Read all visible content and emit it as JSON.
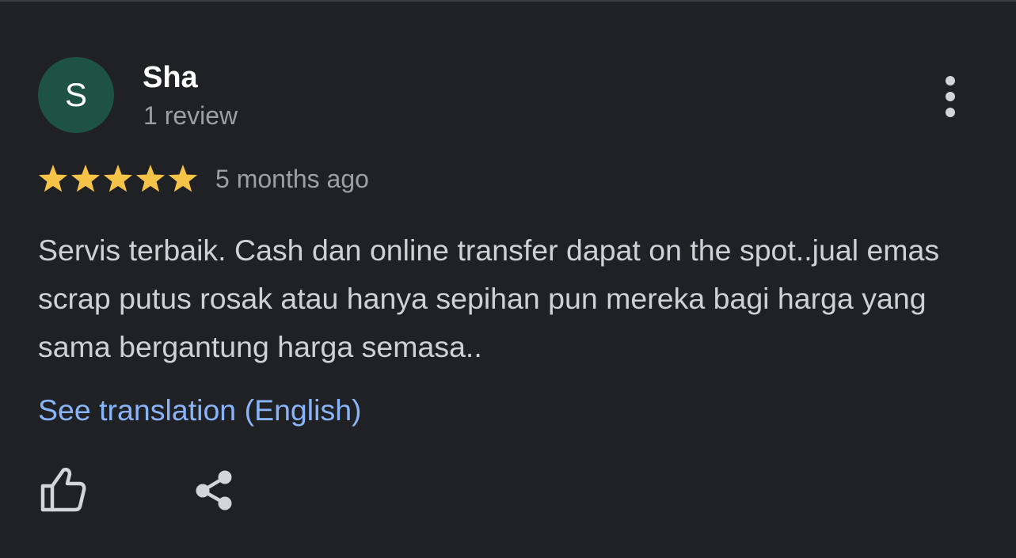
{
  "review": {
    "author": {
      "initial": "S",
      "name": "Sha",
      "review_count": "1 review",
      "avatar_color": "#1e5242"
    },
    "rating": 5,
    "max_rating": 5,
    "time_ago": "5 months ago",
    "text": "Servis terbaik. Cash dan online transfer dapat on the spot..jual emas scrap putus rosak atau hanya sepihan pun mereka bagi harga yang sama bergantung harga semasa..",
    "translate_link": "See translation (English)"
  },
  "icons": {
    "more": "more-vertical-icon",
    "star": "star-icon",
    "like": "thumbs-up-icon",
    "share": "share-icon"
  },
  "colors": {
    "background": "#202124",
    "star": "#f5c348",
    "link": "#8ab4f8",
    "text": "#d0d1d4",
    "secondary_text": "#9aa0a6"
  }
}
